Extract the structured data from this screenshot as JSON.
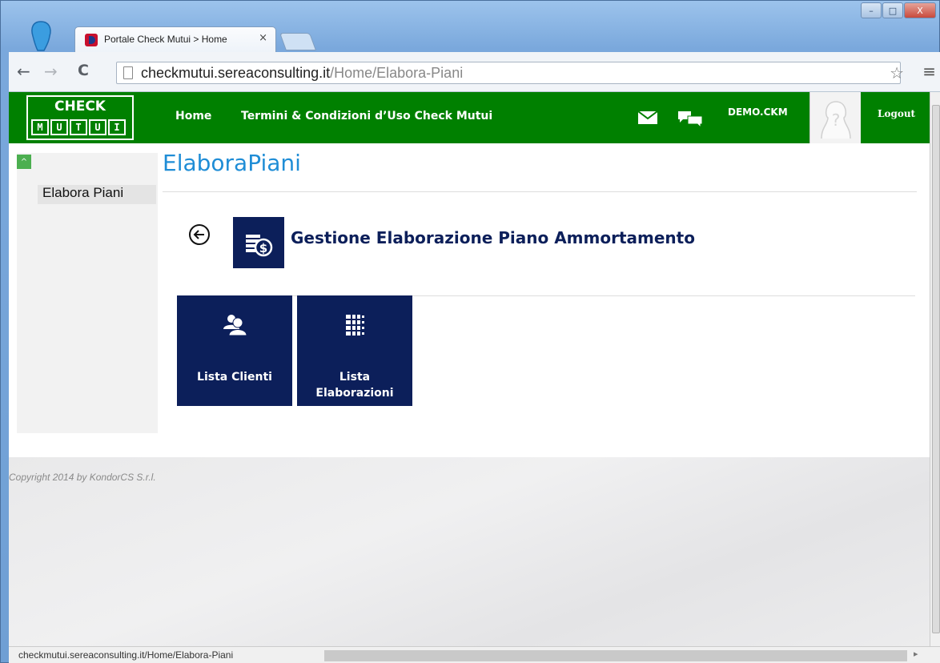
{
  "browser": {
    "tab_title": "Portale Check Mutui > Home",
    "tab_close": "×",
    "url_host": "checkmutui.sereaconsulting.it",
    "url_path": "/Home/Elabora-Piani",
    "status_url": "checkmutui.sereaconsulting.it/Home/Elabora-Piani",
    "back_glyph": "←",
    "forward_glyph": "→",
    "reload_glyph": "C",
    "star_glyph": "☆",
    "menu_glyph": "≡",
    "minimize_glyph": "–",
    "maximize_glyph": "□",
    "close_glyph": "X"
  },
  "header": {
    "logo_top": "CHECK",
    "logo_letters": [
      "M",
      "U",
      "T",
      "U",
      "I"
    ],
    "nav": [
      "Home",
      "Termini & Condizioni d’Uso Check Mutui"
    ],
    "username": "DEMO.CKM",
    "logout": "Logout",
    "accent": "#008000"
  },
  "sidebar": {
    "toggle_glyph": "^",
    "items": [
      {
        "label": "Elabora Piani"
      }
    ]
  },
  "main": {
    "page_title": "ElaboraPiani",
    "section_title": "Gestione Elaborazione Piano Ammortamento",
    "tiles": [
      {
        "label": "Lista Clienti",
        "icon": "users-icon"
      },
      {
        "label": "Lista Elaborazioni",
        "icon": "grid-list-icon"
      }
    ],
    "navy": "#0c1f5a"
  },
  "footer": {
    "copyright": "Copyright 2014 by KondorCS S.r.l."
  }
}
